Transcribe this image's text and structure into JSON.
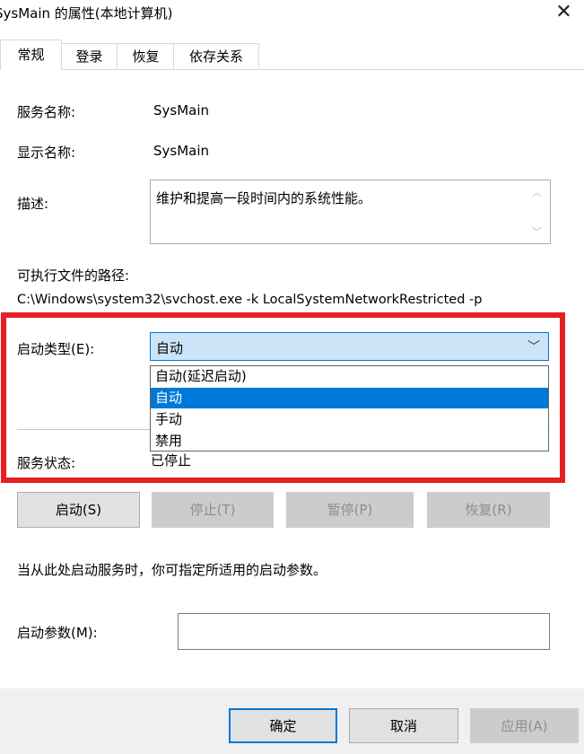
{
  "window": {
    "title": "SysMain 的属性(本地计算机)",
    "close_glyph": "✕"
  },
  "tabs": [
    {
      "label": "常规",
      "active": true
    },
    {
      "label": "登录",
      "active": false
    },
    {
      "label": "恢复",
      "active": false
    },
    {
      "label": "依存关系",
      "active": false
    }
  ],
  "general": {
    "service_name_label": "服务名称:",
    "service_name": "SysMain",
    "display_name_label": "显示名称:",
    "display_name": "SysMain",
    "description_label": "描述:",
    "description": "维护和提高一段时间内的系统性能。",
    "exe_path_label": "可执行文件的路径:",
    "exe_path": "C:\\Windows\\system32\\svchost.exe -k LocalSystemNetworkRestricted -p",
    "startup_type_label": "启动类型(E):",
    "startup_type_value": "自动",
    "startup_options": [
      "自动(延迟启动)",
      "自动",
      "手动",
      "禁用"
    ],
    "startup_selected_index": 1,
    "service_status_label": "服务状态:",
    "service_status": "已停止"
  },
  "service_buttons": {
    "start": "启动(S)",
    "stop": "停止(T)",
    "pause": "暂停(P)",
    "resume": "恢复(R)"
  },
  "hint_text": "当从此处启动服务时，你可指定所适用的启动参数。",
  "start_params": {
    "label": "启动参数(M):",
    "value": ""
  },
  "footer": {
    "ok": "确定",
    "cancel": "取消",
    "apply": "应用(A)"
  },
  "colors": {
    "highlight": "#0078d7",
    "annotation_frame": "#e81e25",
    "combo_bg": "#cce4f7"
  }
}
